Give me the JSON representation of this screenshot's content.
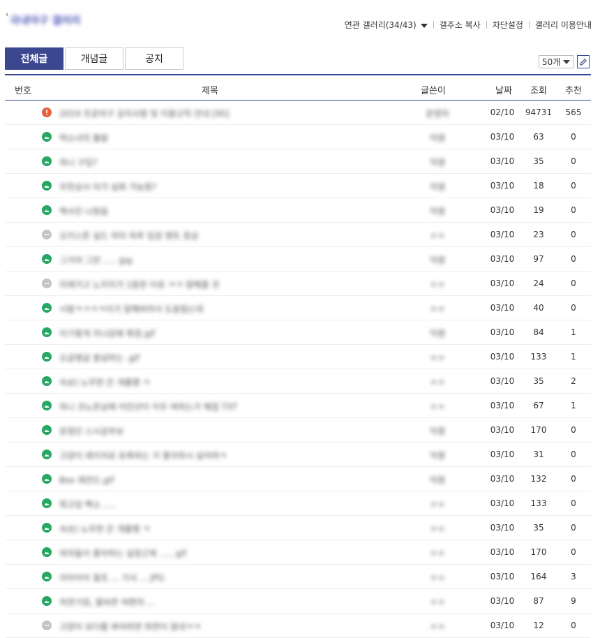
{
  "header": {
    "gallery_title": "국내야구 갤러리",
    "links": [
      "연관 갤러리(34/43)",
      "갤주소 복사",
      "차단설정",
      "갤러리 이용안내"
    ]
  },
  "tabs": [
    "전체글",
    "개념글",
    "공지"
  ],
  "page_size": "50개",
  "columns": {
    "num": "번호",
    "title": "제목",
    "writer": "글쓴이",
    "date": "날짜",
    "views": "조회",
    "rec": "추천"
  },
  "rows": [
    {
      "icon": "notice",
      "title": "2019 프로야구 공지사항 및 이용규칙 안내 [95]",
      "writer": "운영자",
      "date": "02/10",
      "views": "94731",
      "rec": "565"
    },
    {
      "icon": "image",
      "title": "떡소녀의 출발",
      "writer": "익명",
      "date": "03/10",
      "views": "63",
      "rec": "0"
    },
    {
      "icon": "image",
      "title": "하나 구입?",
      "writer": "익명",
      "date": "03/10",
      "views": "35",
      "rec": "0"
    },
    {
      "icon": "image",
      "title": "무한상사 아가 실화 가능함?",
      "writer": "익명",
      "date": "03/10",
      "views": "18",
      "rec": "0"
    },
    {
      "icon": "image",
      "title": "백사진 나왔음",
      "writer": "익명",
      "date": "03/10",
      "views": "19",
      "rec": "0"
    },
    {
      "icon": "chat",
      "title": "오키스톤 실드 여자 하루 입장 멘트 증상",
      "writer": "ㅇㅇ",
      "date": "03/10",
      "views": "23",
      "rec": "0"
    },
    {
      "icon": "image",
      "title": "그거야 그런 ..... jpg",
      "writer": "익명",
      "date": "03/10",
      "views": "97",
      "rec": "0"
    },
    {
      "icon": "chat",
      "title": "미래가고 노지지가 1등한 이유 ㅋㅋ 말해줄 것",
      "writer": "ㅇㅇ",
      "date": "03/10",
      "views": "24",
      "rec": "0"
    },
    {
      "icon": "image",
      "title": "시발ㅋㅋㅋㅋ이거 말해버려서 도움됬는데",
      "writer": "ㅇㅇ",
      "date": "03/10",
      "views": "40",
      "rec": "0"
    },
    {
      "icon": "image",
      "title": "이기렇게 지나감에 확정.gif",
      "writer": "익명",
      "date": "03/10",
      "views": "84",
      "rec": "1"
    },
    {
      "icon": "image",
      "title": "오글맹글 중념하는 .gif",
      "writer": "ㅇㅇ",
      "date": "03/10",
      "views": "133",
      "rec": "1"
    },
    {
      "icon": "image",
      "title": "속보) 노무현 은 개를했 ㅋ",
      "writer": "ㅇㅇ",
      "date": "03/10",
      "views": "35",
      "rec": "2"
    },
    {
      "icon": "image",
      "title": "하니 코노돈남에 어린년이 이주 여하는거 해접 TXT",
      "writer": "ㅇㅇ",
      "date": "03/10",
      "views": "67",
      "rec": "1"
    },
    {
      "icon": "image",
      "title": "분점단 스시공부보",
      "writer": "익명",
      "date": "03/10",
      "views": "170",
      "rec": "0"
    },
    {
      "icon": "image",
      "title": "고양이 레이저로 유혹하는 거 좋아하시 실어여ㅋ",
      "writer": "익명",
      "date": "03/10",
      "views": "31",
      "rec": "0"
    },
    {
      "icon": "image",
      "title": "Box 레전드.gif",
      "writer": "익명",
      "date": "03/10",
      "views": "132",
      "rec": "0"
    },
    {
      "icon": "image",
      "title": "뭐고임 빡소 .....",
      "writer": "ㅇㅇ",
      "date": "03/10",
      "views": "133",
      "rec": "0"
    },
    {
      "icon": "image",
      "title": "속보) 노무현 은 개를했 ㅋ",
      "writer": "ㅇㅇ",
      "date": "03/10",
      "views": "35",
      "rec": "0"
    },
    {
      "icon": "image",
      "title": "여자들이 좋아하는 실장근육 ......gif",
      "writer": "ㅇㅇ",
      "date": "03/10",
      "views": "170",
      "rec": "0"
    },
    {
      "icon": "image",
      "title": "아아아아 월조 ... 가서 ... JPG",
      "writer": "ㅇㅇ",
      "date": "03/10",
      "views": "164",
      "rec": "3"
    },
    {
      "icon": "image",
      "title": "허연기침, 올바른 여편의 ...",
      "writer": "ㅇㅇ",
      "date": "03/10",
      "views": "87",
      "rec": "9"
    },
    {
      "icon": "chat",
      "title": "고양이 보다를 봐야하면 하면이 많네ㅋㅋ",
      "writer": "ㅇㅇ",
      "date": "03/10",
      "views": "12",
      "rec": "0"
    }
  ]
}
